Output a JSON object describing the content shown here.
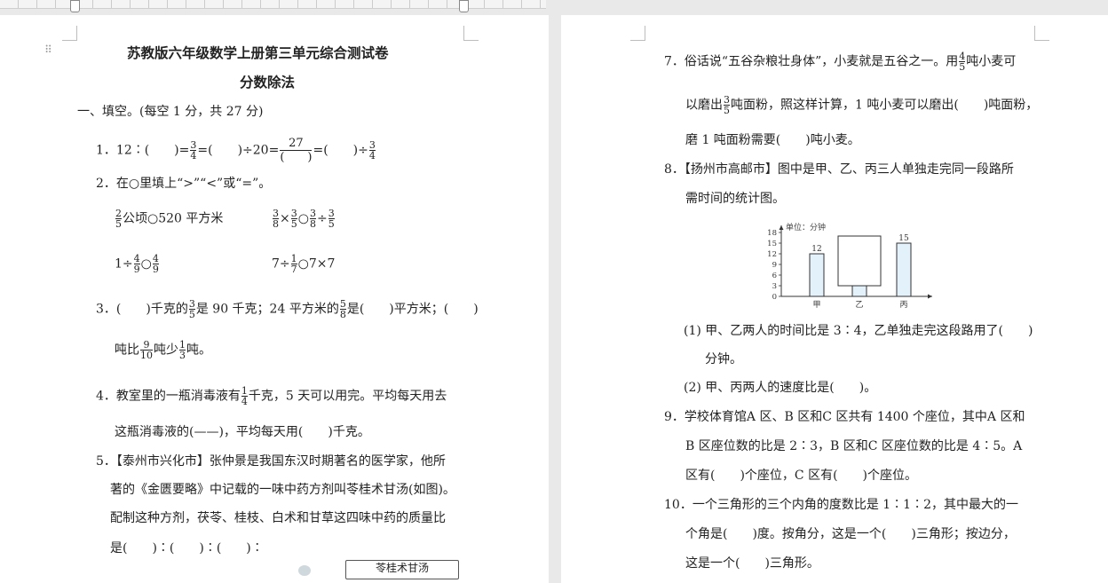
{
  "left": {
    "title": "苏教版六年级数学上册第三单元综合测试卷",
    "subtitle": "分数除法",
    "section1": "一、填空。(每空 1 分，共 27 分)",
    "q1": {
      "num": "1．12∶(　　)=",
      "a": [
        "3",
        "4"
      ],
      "mid": "=(　　)÷20=",
      "b": [
        "27",
        "(　　)"
      ],
      "mid2": "=(　　)÷",
      "c": [
        "3",
        "4"
      ]
    },
    "q2": "2．在○里填上“>”“<”或“=”。",
    "q2a": {
      "f": [
        "2",
        "5"
      ],
      "text": "公顷○520 平方米"
    },
    "q2b": {
      "f1": [
        "3",
        "8"
      ],
      "op1": "×",
      "f2": [
        "3",
        "5"
      ],
      "op2": "○",
      "f3": [
        "3",
        "8"
      ],
      "op3": "÷",
      "f4": [
        "3",
        "5"
      ]
    },
    "q2c": {
      "pre": "1÷",
      "f1": [
        "4",
        "9"
      ],
      "op": "○",
      "f2": [
        "4",
        "9"
      ]
    },
    "q2d": {
      "pre": "7÷",
      "f1": [
        "1",
        "7"
      ],
      "post": "○7×7"
    },
    "q3": {
      "pre": "3．(　　)千克的",
      "f1": [
        "3",
        "5"
      ],
      "mid": "是 90 千克；24 平方米的",
      "f2": [
        "5",
        "8"
      ],
      "post": "是(　　)平方米；(　　)"
    },
    "q3b": {
      "pre": "吨比",
      "f1": [
        "9",
        "10"
      ],
      "mid": "吨少",
      "f2": [
        "1",
        "3"
      ],
      "post": "吨。"
    },
    "q4": {
      "pre": "4．教室里的一瓶消毒液有",
      "f": [
        "1",
        "4"
      ],
      "post": "千克，5 天可以用完。平均每天用去"
    },
    "q4b": "这瓶消毒液的(——)，平均每天用(　　)千克。",
    "q5": "5．【泰州市兴化市】张仲景是我国东汉时期著名的医学家，他所",
    "q5b": "著的《金匮要略》中记载的一味中药方剂叫苓桂术甘汤(如图)。",
    "q5c": "配制这种方剂，茯苓、桂枝、白术和甘草这四味中药的质量比",
    "q5d": "是(　　)∶(　　)∶(　　)∶",
    "recipe_label": "苓桂术甘汤"
  },
  "right": {
    "q7": {
      "pre": "7．俗话说“五谷杂粮壮身体”，小麦就是五谷之一。用",
      "f": [
        "4",
        "5"
      ],
      "post": "吨小麦可"
    },
    "q7b": {
      "pre": "以磨出",
      "f": [
        "3",
        "5"
      ],
      "post": "吨面粉，照这样计算，1 吨小麦可以磨出(　　)吨面粉，"
    },
    "q7c": "磨 1 吨面粉需要(　　)吨小麦。",
    "q8": "8．【扬州市高邮市】图中是甲、乙、丙三人单独走完同一段路所",
    "q8b": "需时间的统计图。",
    "q8_1": "(1) 甲、乙两人的时间比是 3∶4，乙单独走完这段路用了(　　)",
    "q8_1b": "分钟。",
    "q8_2": "(2) 甲、丙两人的速度比是(　　)。",
    "q9": "9．学校体育馆A 区、B 区和C 区共有 1400 个座位，其中A 区和",
    "q9b": "B 区座位数的比是 2∶3，B 区和C 区座位数的比是 4∶5。A",
    "q9c": "区有(　　)个座位，C 区有(　　)个座位。",
    "q10": "10．一个三角形的三个内角的度数比是 1∶1∶2，其中最大的一",
    "q10b": "个角是(　　)度。按角分，这是一个(　　)三角形；按边分，",
    "q10c": "这是一个(　　)三角形。"
  },
  "chart_data": {
    "type": "bar",
    "ylabel": "单位：分钟",
    "categories": [
      "甲",
      "乙",
      "丙"
    ],
    "values": [
      12,
      null,
      15
    ],
    "data_labels": [
      "12",
      "",
      "15"
    ],
    "yticks": [
      0,
      3,
      6,
      9,
      12,
      15,
      18
    ],
    "ylim": [
      0,
      18
    ],
    "note": "乙's bar is covered by a blank box; visible stub reaches 3"
  }
}
